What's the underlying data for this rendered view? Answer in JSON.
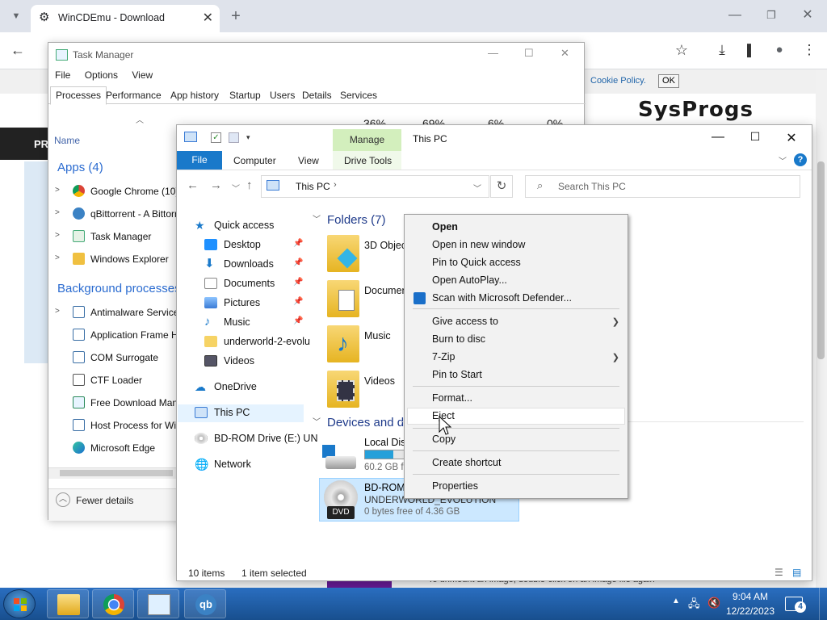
{
  "chrome": {
    "tab_title": "WinCDEmu - Download",
    "cookie_text": "Cookie Policy.",
    "cookie_ok": "OK",
    "logo": "SysProgs",
    "dark_bar_text": "PR",
    "bottom_text": "To unmount an image, double-click on an image file again"
  },
  "taskmgr": {
    "title": "Task Manager",
    "menu": [
      "File",
      "Options",
      "View"
    ],
    "tabs": [
      "Processes",
      "Performance",
      "App history",
      "Startup",
      "Users",
      "Details",
      "Services"
    ],
    "percents": [
      "36%",
      "69%",
      "6%",
      "0%"
    ],
    "col_name": "Name",
    "apps_header": "Apps (4)",
    "apps": [
      "Google Chrome (10)",
      "qBittorrent - A Bittorrent",
      "Task Manager",
      "Windows Explorer"
    ],
    "bg_header": "Background processes",
    "bg": [
      "Antimalware Service",
      "Application Frame H",
      "COM Surrogate",
      "CTF Loader",
      "Free Download Man",
      "Host Process for Wir",
      "Microsoft Edge"
    ],
    "fewer_details": "Fewer details"
  },
  "explorer": {
    "title": "This PC",
    "manage": "Manage",
    "ribbon": {
      "file": "File",
      "computer": "Computer",
      "view": "View",
      "drive_tools": "Drive Tools"
    },
    "address": "This PC",
    "search_placeholder": "Search This PC",
    "nav": {
      "quick_access": "Quick access",
      "desktop": "Desktop",
      "downloads": "Downloads",
      "documents": "Documents",
      "pictures": "Pictures",
      "music": "Music",
      "underworld": "underworld-2-evolu",
      "videos": "Videos",
      "onedrive": "OneDrive",
      "this_pc": "This PC",
      "bdrom": "BD-ROM Drive (E:) UN",
      "network": "Network"
    },
    "folders_header": "Folders (7)",
    "folders": [
      "3D Objects",
      "Documents",
      "Music",
      "Videos"
    ],
    "devices_header": "Devices and drives",
    "local_disk": "Local Disk",
    "local_disk_free": "60.2 GB fr",
    "local_disk_fill": 0.7,
    "bdrom_line1": "BD-ROM",
    "bdrom_line2": "UNDERWORLD_EVOLUTION",
    "bdrom_free": "0 bytes free of 4.36 GB",
    "dvd_badge": "DVD",
    "status_items": "10 items",
    "status_selected": "1 item selected"
  },
  "context_menu": {
    "open": "Open",
    "open_new_window": "Open in new window",
    "pin_quick": "Pin to Quick access",
    "autoplay": "Open AutoPlay...",
    "defender": "Scan with Microsoft Defender...",
    "give_access": "Give access to",
    "burn": "Burn to disc",
    "zip": "7-Zip",
    "pin_start": "Pin to Start",
    "format": "Format...",
    "eject": "Eject",
    "copy": "Copy",
    "create_shortcut": "Create shortcut",
    "properties": "Properties"
  },
  "taskbar": {
    "time": "9:04 AM",
    "date": "12/22/2023",
    "notifications": "4"
  }
}
